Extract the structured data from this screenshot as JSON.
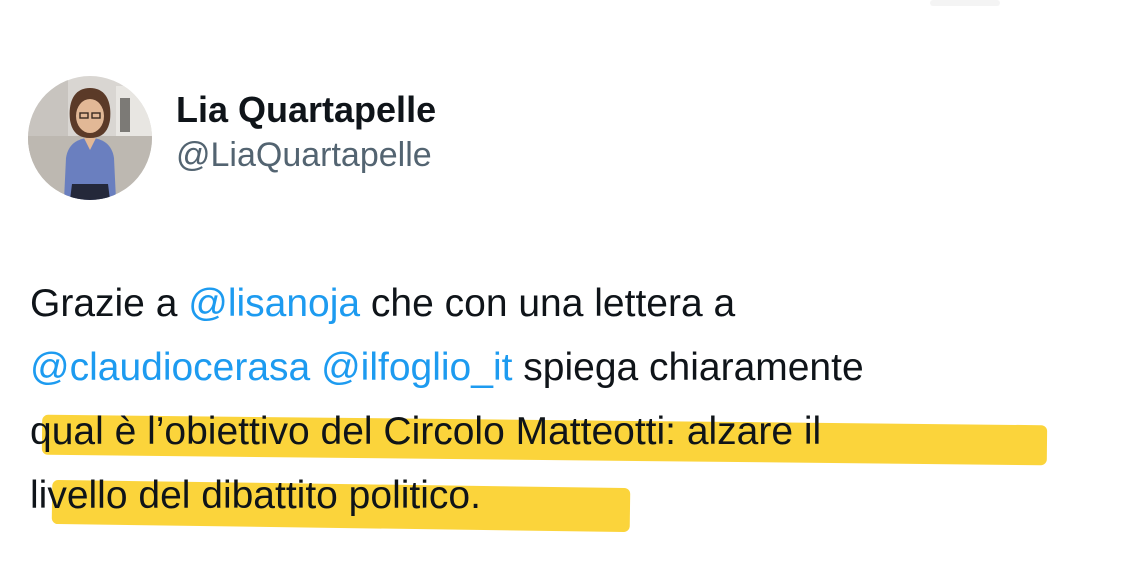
{
  "author": {
    "display_name": "Lia Quartapelle",
    "handle": "@LiaQuartapelle"
  },
  "tweet": {
    "line1": {
      "pre": "Grazie a ",
      "mention": "@lisanoja",
      "post": " che con una lettera a"
    },
    "line2": {
      "mention1": "@claudiocerasa",
      "space": " ",
      "mention2": "@ilfoglio_it",
      "post": " spiega chiaramente"
    },
    "line3": "qual è l’obiettivo del Circolo Matteotti: alzare il",
    "line4": "livello del dibattito politico."
  },
  "colors": {
    "mention": "#1d9bf0",
    "highlight": "#fbd02a",
    "handle": "#536471",
    "text": "#0f1419"
  },
  "icons": {
    "avatar": "profile-photo"
  }
}
